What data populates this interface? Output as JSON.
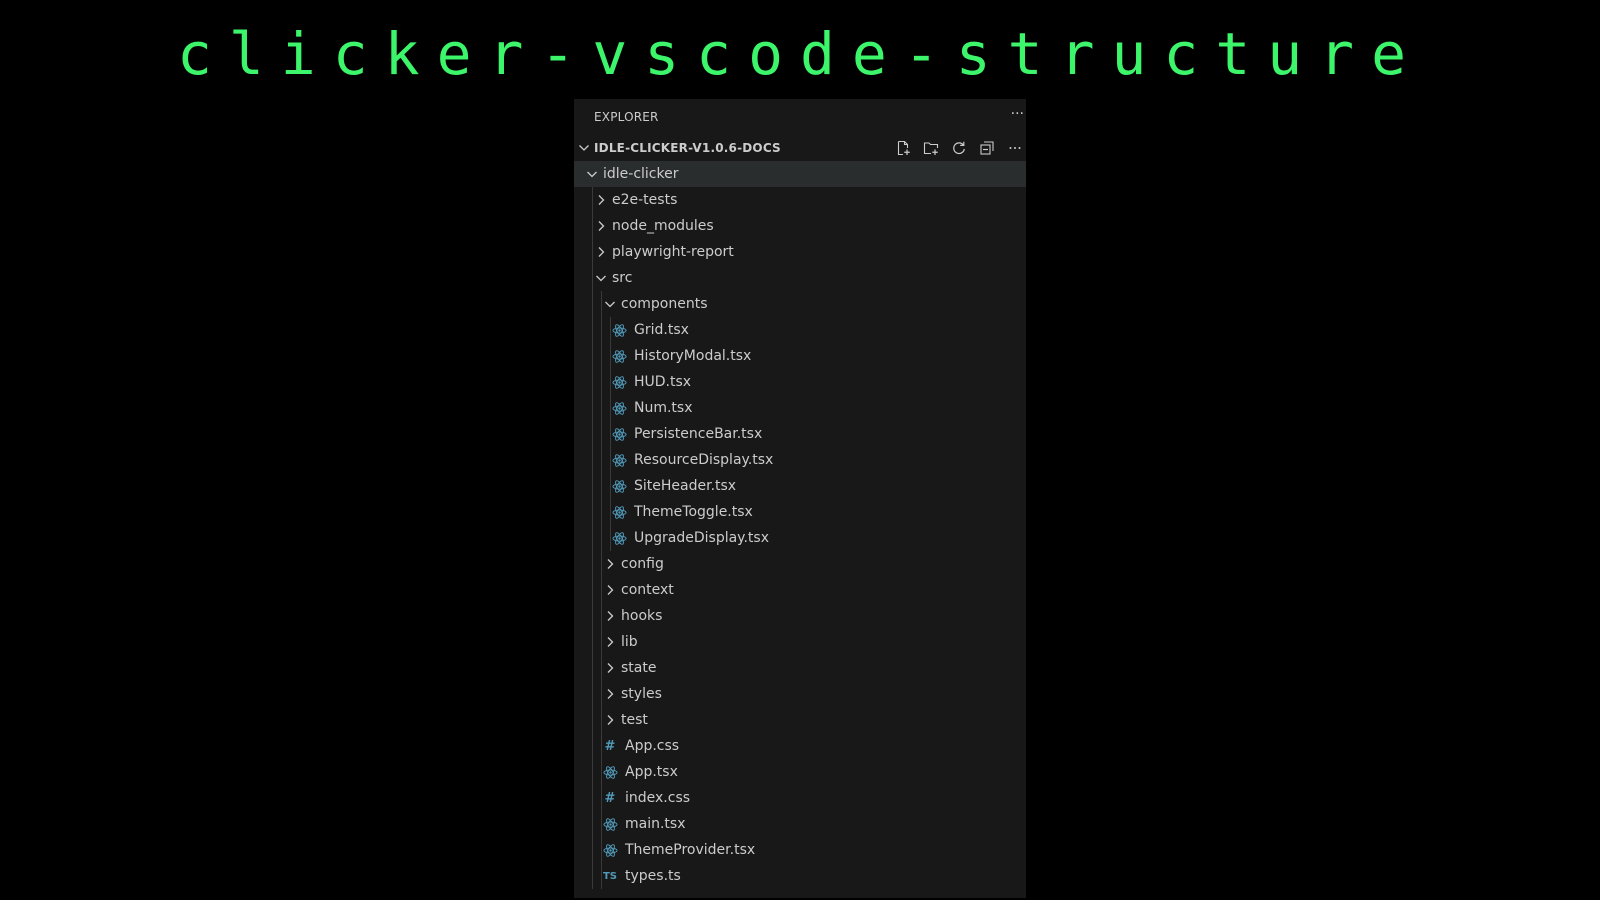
{
  "banner": {
    "title": "clicker-vscode-structure",
    "color": "#3cf56a"
  },
  "explorer": {
    "title": "EXPLORER",
    "more": "···",
    "workspace": {
      "label": "IDLE-CLICKER-V1.0.6-DOCS",
      "actions": [
        {
          "name": "new-file-icon",
          "title": "New File"
        },
        {
          "name": "new-folder-icon",
          "title": "New Folder"
        },
        {
          "name": "refresh-icon",
          "title": "Refresh"
        },
        {
          "name": "collapse-all-icon",
          "title": "Collapse All"
        },
        {
          "name": "more-actions-icon",
          "title": "More Actions"
        }
      ]
    },
    "tree": [
      {
        "label": "idle-clicker",
        "kind": "folder",
        "depth": 0,
        "expanded": true,
        "selected": true
      },
      {
        "label": "e2e-tests",
        "kind": "folder",
        "depth": 1,
        "expanded": false
      },
      {
        "label": "node_modules",
        "kind": "folder",
        "depth": 1,
        "expanded": false
      },
      {
        "label": "playwright-report",
        "kind": "folder",
        "depth": 1,
        "expanded": false
      },
      {
        "label": "src",
        "kind": "folder",
        "depth": 1,
        "expanded": true
      },
      {
        "label": "components",
        "kind": "folder",
        "depth": 2,
        "expanded": true
      },
      {
        "label": "Grid.tsx",
        "kind": "react",
        "depth": 3
      },
      {
        "label": "HistoryModal.tsx",
        "kind": "react",
        "depth": 3
      },
      {
        "label": "HUD.tsx",
        "kind": "react",
        "depth": 3
      },
      {
        "label": "Num.tsx",
        "kind": "react",
        "depth": 3
      },
      {
        "label": "PersistenceBar.tsx",
        "kind": "react",
        "depth": 3
      },
      {
        "label": "ResourceDisplay.tsx",
        "kind": "react",
        "depth": 3
      },
      {
        "label": "SiteHeader.tsx",
        "kind": "react",
        "depth": 3
      },
      {
        "label": "ThemeToggle.tsx",
        "kind": "react",
        "depth": 3
      },
      {
        "label": "UpgradeDisplay.tsx",
        "kind": "react",
        "depth": 3
      },
      {
        "label": "config",
        "kind": "folder",
        "depth": 2,
        "expanded": false
      },
      {
        "label": "context",
        "kind": "folder",
        "depth": 2,
        "expanded": false
      },
      {
        "label": "hooks",
        "kind": "folder",
        "depth": 2,
        "expanded": false
      },
      {
        "label": "lib",
        "kind": "folder",
        "depth": 2,
        "expanded": false
      },
      {
        "label": "state",
        "kind": "folder",
        "depth": 2,
        "expanded": false
      },
      {
        "label": "styles",
        "kind": "folder",
        "depth": 2,
        "expanded": false
      },
      {
        "label": "test",
        "kind": "folder",
        "depth": 2,
        "expanded": false
      },
      {
        "label": "App.css",
        "kind": "css",
        "depth": 2
      },
      {
        "label": "App.tsx",
        "kind": "react",
        "depth": 2
      },
      {
        "label": "index.css",
        "kind": "css",
        "depth": 2
      },
      {
        "label": "main.tsx",
        "kind": "react",
        "depth": 2
      },
      {
        "label": "ThemeProvider.tsx",
        "kind": "react",
        "depth": 2
      },
      {
        "label": "types.ts",
        "kind": "ts",
        "depth": 2,
        "icon_text": "TS"
      }
    ]
  },
  "colors": {
    "panel_bg": "#181818",
    "selected_bg": "#2a2d2e",
    "text": "#cccccc",
    "react_icon": "#519aba",
    "css_icon": "#519aba",
    "ts_icon": "#519aba"
  }
}
